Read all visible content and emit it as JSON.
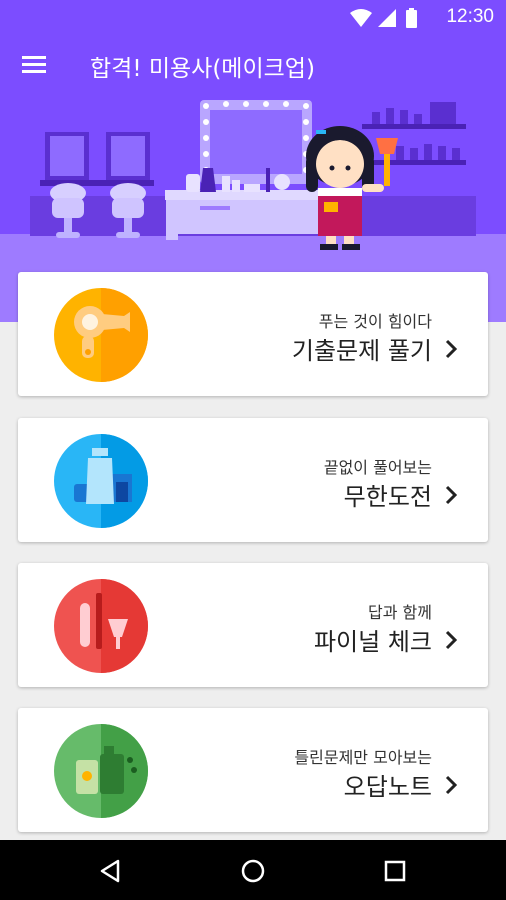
{
  "status_bar": {
    "time": "12:30",
    "icons": [
      "wifi-icon",
      "signal-icon",
      "battery-icon"
    ]
  },
  "app_bar": {
    "title": "합격! 미용사(메이크업)",
    "menu_icon": "menu-icon"
  },
  "colors": {
    "primary": "#7c4dff",
    "hero_light": "#9e7bff",
    "card_yellow": "#ffb300",
    "card_blue": "#29b6f6",
    "card_red": "#ef5350",
    "card_green": "#66bb6a"
  },
  "menu_cards": [
    {
      "subtitle": "푸는 것이 힘이다",
      "title": "기출문제 풀기",
      "icon": "hair-dryer-icon"
    },
    {
      "subtitle": "끝없이 풀어보는",
      "title": "무한도전",
      "icon": "cosmetics-bottles-icon"
    },
    {
      "subtitle": "답과 함께",
      "title": "파이널 체크",
      "icon": "makeup-brushes-icon"
    },
    {
      "subtitle": "틀린문제만 모아보는",
      "title": "오답노트",
      "icon": "sunscreen-icon"
    }
  ],
  "nav_bar": {
    "buttons": [
      "back-icon",
      "home-icon",
      "recents-icon"
    ]
  }
}
